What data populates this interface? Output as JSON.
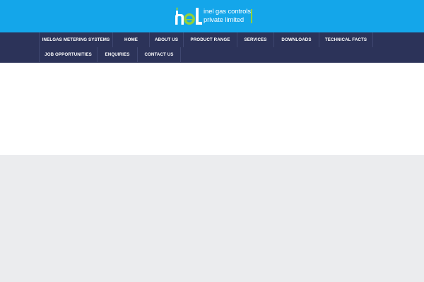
{
  "header": {
    "logo": {
      "mark_text": "nel",
      "line1": "inel gas controls",
      "line2": "private limited"
    }
  },
  "nav": {
    "items": [
      {
        "label": "INELGAS METERING SYSTEMS"
      },
      {
        "label": "HOME"
      },
      {
        "label": "ABOUT US"
      },
      {
        "label": "PRODUCT RANGE"
      },
      {
        "label": "SERVICES"
      },
      {
        "label": "DOWNLOADS"
      },
      {
        "label": "TECHNICAL FACTS"
      },
      {
        "label": "JOB OPPORTUNITIES"
      },
      {
        "label": "ENQUIRIES"
      },
      {
        "label": "CONTACT US"
      }
    ]
  },
  "colors": {
    "header_bg": "#14a6ea",
    "nav_bg": "#2c3359",
    "accent_green": "#8fd13b",
    "page_bg": "#ebecee"
  }
}
